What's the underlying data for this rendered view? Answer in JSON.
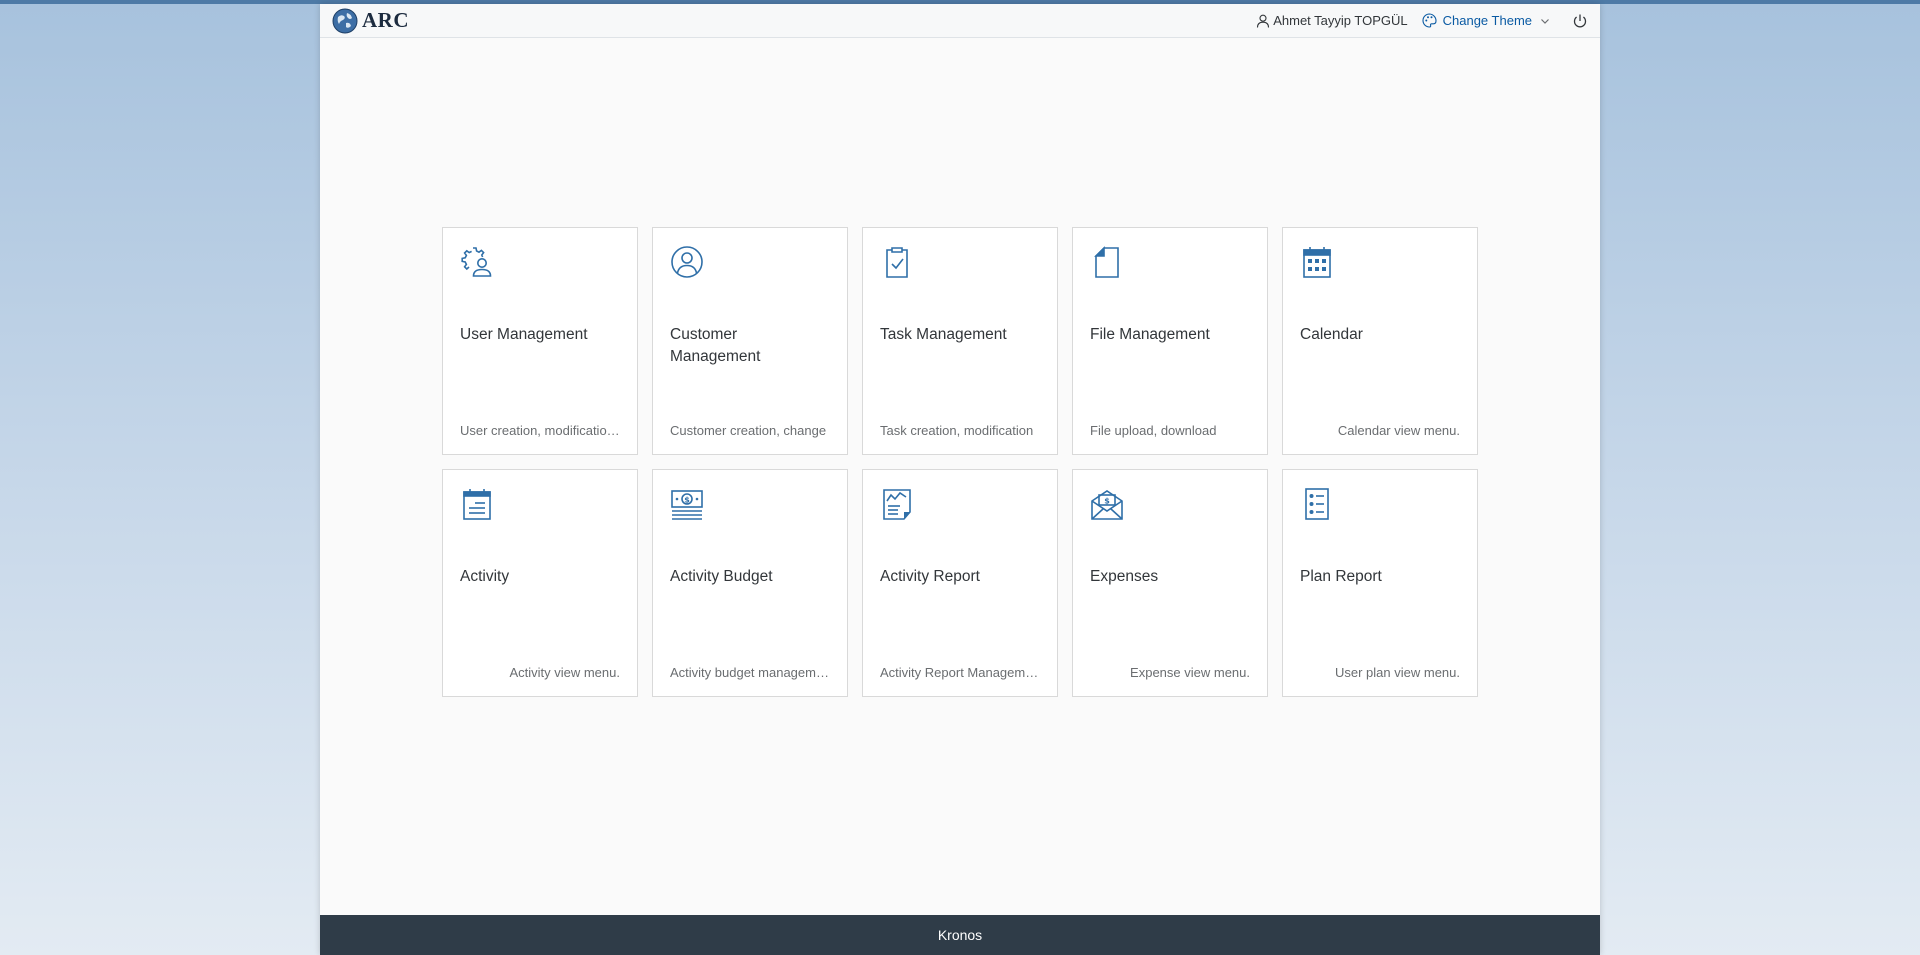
{
  "header": {
    "logo_text": "ARC",
    "user_name": "Ahmet Tayyip TOPGÜL",
    "theme_label": "Change Theme"
  },
  "tiles": [
    {
      "title": "User Management",
      "subtitle": "User creation, modification, deletion",
      "icon": "user-settings-icon"
    },
    {
      "title": "Customer Management",
      "subtitle": "Customer creation, change",
      "icon": "customer-icon"
    },
    {
      "title": "Task Management",
      "subtitle": "Task creation, modification",
      "icon": "task-icon"
    },
    {
      "title": "File Management",
      "subtitle": "File upload, download",
      "icon": "document-icon"
    },
    {
      "title": "Calendar",
      "subtitle": "Calendar view menu.",
      "icon": "calendar-icon"
    },
    {
      "title": "Activity",
      "subtitle": "Activity view menu.",
      "icon": "activity-icon"
    },
    {
      "title": "Activity Budget",
      "subtitle": "Activity budget management",
      "icon": "money-bills-icon"
    },
    {
      "title": "Activity Report",
      "subtitle": "Activity Report Management",
      "icon": "report-icon"
    },
    {
      "title": "Expenses",
      "subtitle": "Expense view menu.",
      "icon": "expense-mail-icon"
    },
    {
      "title": "Plan Report",
      "subtitle": "User plan view menu.",
      "icon": "checklist-icon"
    }
  ],
  "footer": {
    "text": "Kronos"
  },
  "colors": {
    "accent": "#2f6fa8",
    "footer_bg": "#2f3c48",
    "link": "#0a5aa3"
  }
}
